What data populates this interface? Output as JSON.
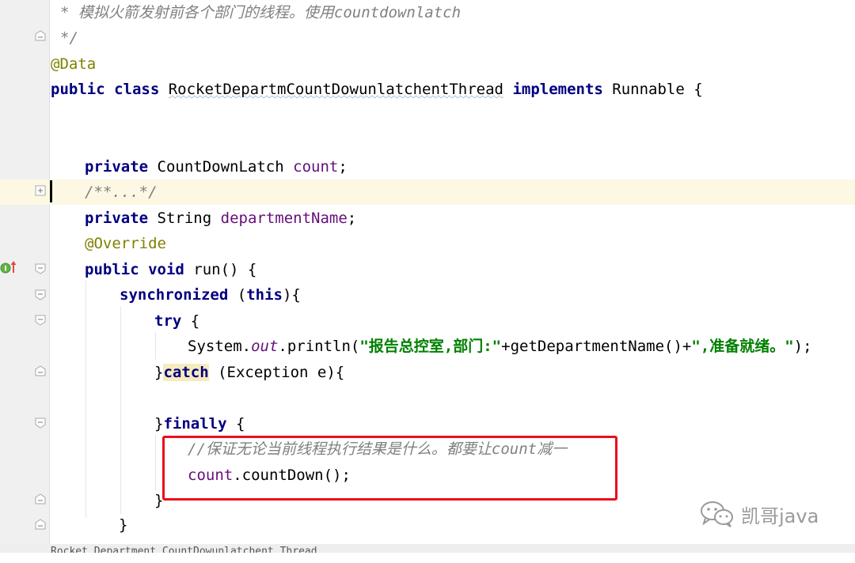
{
  "editor": {
    "lines": {
      "l1": "* 模拟火箭发射前各个部门的线程。使用countdownlatch",
      "l2": "*/",
      "l3": "@Data",
      "l4_kw": "public class",
      "l4_name": "RocketDepartmCountDowunlatchentThread",
      "l4_impl": "implements",
      "l4_rest": "Runnable {",
      "l7_kw": "private",
      "l7_type": "CountDownLatch",
      "l7_field": "count",
      "l7_end": ";",
      "l8": "/**...*/",
      "l9_kw": "private",
      "l9_type": "String",
      "l9_field": "departmentName",
      "l9_end": ";",
      "l10": "@Override",
      "l11_kw": "public void",
      "l11_rest": "run() {",
      "l12_kw": "synchronized",
      "l12_open": "(",
      "l12_this": "this",
      "l12_close": "){",
      "l13_kw": "try",
      "l13_rest": "{",
      "l14_pre": "System.",
      "l14_out": "out",
      "l14_mid": ".println(",
      "l14_str1": "\"报告总控室,部门:\"",
      "l14_plus": "+getDepartmentName()+",
      "l14_str2": "\",准备就绪。\"",
      "l14_end": ");",
      "l15_brace": "}",
      "l15_catch": "catch",
      "l15_rest": " (Exception e){",
      "l17_brace": "}",
      "l17_finally": "finally",
      "l17_rest": " {",
      "l18": "//保证无论当前线程执行结果是什么。都要让count减一",
      "l19_field": "count",
      "l19_rest": ".countDown();",
      "l20": "}",
      "l21": "}",
      "l22": "Rocket Department CountDowunlatchent Thread"
    }
  },
  "gutter": {
    "implements_icon": "implements-method-icon"
  },
  "watermark": {
    "text": "凯哥java",
    "icon": "wechat-icon"
  },
  "colors": {
    "keyword": "#000080",
    "field": "#660e7a",
    "annotation": "#808000",
    "string": "#008000",
    "comment": "#808080",
    "highlight_box": "#e8101a",
    "current_line": "#fcf8e3"
  }
}
